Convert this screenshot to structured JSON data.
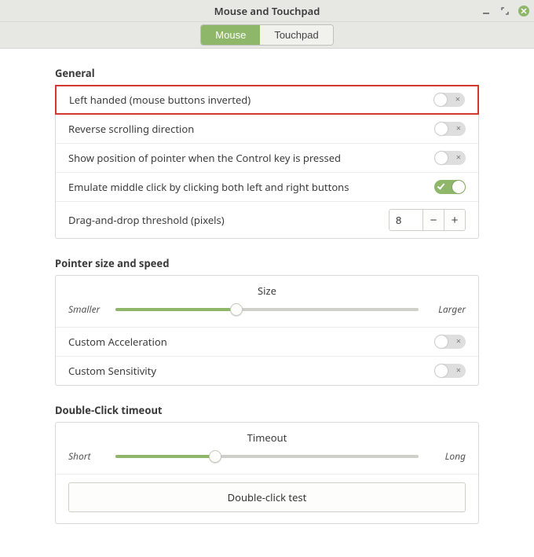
{
  "window": {
    "title": "Mouse and Touchpad"
  },
  "tabs": {
    "mouse": "Mouse",
    "touchpad": "Touchpad",
    "active": "mouse"
  },
  "sections": {
    "general": {
      "title": "General",
      "left_handed": {
        "label": "Left handed (mouse buttons inverted)",
        "on": false
      },
      "reverse_scroll": {
        "label": "Reverse scrolling direction",
        "on": false
      },
      "show_pointer_ctrl": {
        "label": "Show position of pointer when the Control key is pressed",
        "on": false
      },
      "emulate_middle": {
        "label": "Emulate middle click by clicking both left and right buttons",
        "on": true
      },
      "dnd_threshold": {
        "label": "Drag-and-drop threshold (pixels)",
        "value": "8"
      }
    },
    "pointer": {
      "title": "Pointer size and speed",
      "size": {
        "caption": "Size",
        "left": "Smaller",
        "right": "Larger",
        "percent": 40
      },
      "custom_accel": {
        "label": "Custom Acceleration",
        "on": false
      },
      "custom_sens": {
        "label": "Custom Sensitivity",
        "on": false
      }
    },
    "doubleclick": {
      "title": "Double-Click timeout",
      "timeout": {
        "caption": "Timeout",
        "left": "Short",
        "right": "Long",
        "percent": 33
      },
      "test_button": "Double-click test"
    }
  },
  "colors": {
    "accent": "#8fb76a",
    "highlight": "#d33a2f"
  }
}
